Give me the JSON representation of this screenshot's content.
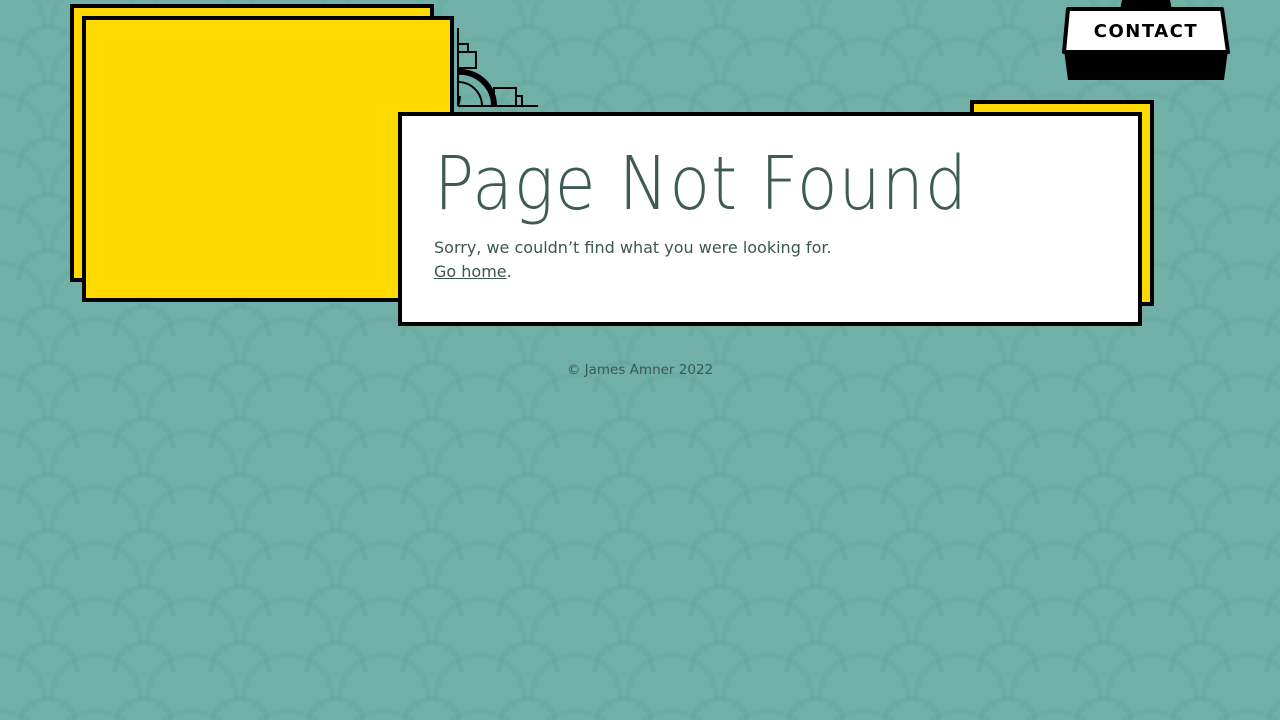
{
  "nav": {
    "contact_label": "CONTACT"
  },
  "main": {
    "title": "Page Not Found",
    "message": "Sorry, we couldn’t find what you were looking for.",
    "home_link": "Go home",
    "home_suffix": "."
  },
  "footer": {
    "copyright": "© James Amner 2022"
  },
  "colors": {
    "background": "#70b0a6",
    "panel_yellow": "#ffd900",
    "border": "#000000",
    "card": "#ffffff",
    "text": "#3b5752"
  }
}
